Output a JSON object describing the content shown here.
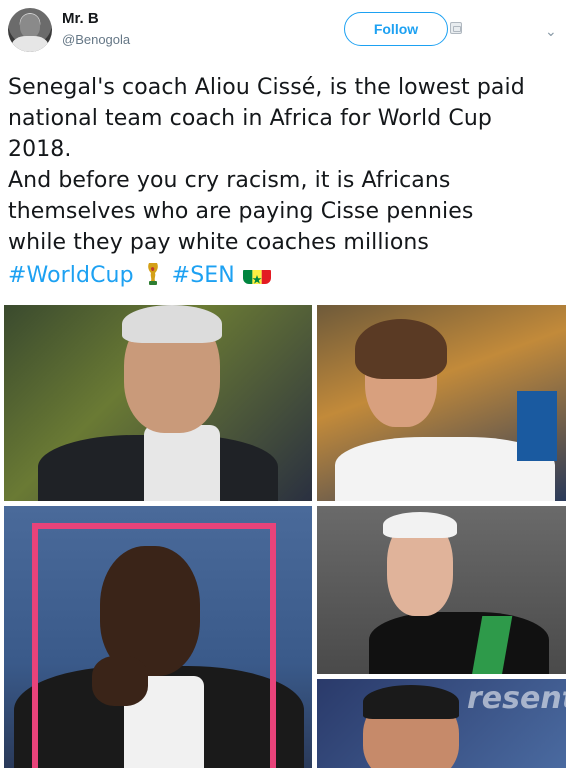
{
  "tweet": {
    "author": {
      "display_name": "Mr. B",
      "handle": "@Benogola",
      "avatar_icon": "user-avatar"
    },
    "follow_label": "Follow",
    "caret_icon": "chevron-down-icon",
    "lines": [
      "Senegal's coach Aliou Cissé, is the lowest paid",
      "national team coach in Africa for World Cup",
      "2018.",
      "And before you cry racism, it is Africans",
      "themselves who are paying Cisse pennies",
      "while they pay white coaches millions"
    ],
    "hashtags": [
      "#WorldCup",
      "#SEN"
    ],
    "emojis": [
      "trophy-icon",
      "senegal-flag-icon"
    ],
    "media": {
      "photo_count": 5,
      "overlay_text": "resent"
    },
    "colors": {
      "accent": "#1da1f2",
      "text": "#14171a",
      "muted": "#657786",
      "highlight_frame": "#e8437a"
    }
  }
}
